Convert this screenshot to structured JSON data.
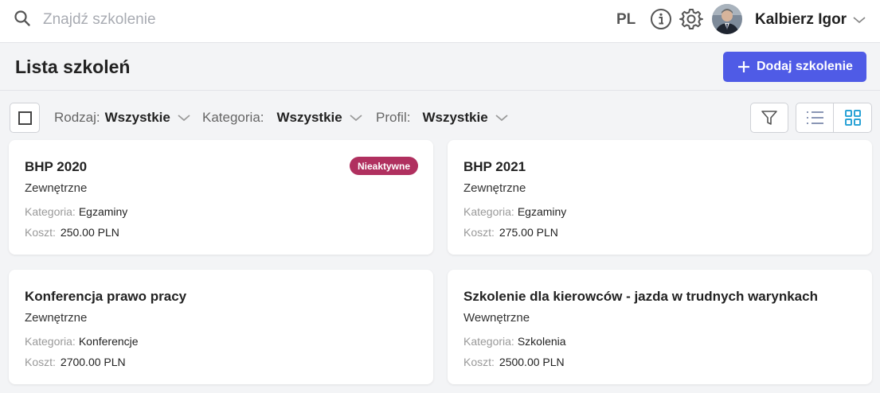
{
  "search": {
    "placeholder": "Znajdź szkolenie"
  },
  "header": {
    "language": "PL",
    "user_name": "Kalbierz Igor"
  },
  "page": {
    "title": "Lista szkoleń",
    "add_button_label": "Dodaj szkolenie"
  },
  "filters": [
    {
      "label": "Rodzaj:",
      "value": "Wszystkie"
    },
    {
      "label": "Kategoria:",
      "value": "Wszystkie"
    },
    {
      "label": "Profil:",
      "value": "Wszystkie"
    }
  ],
  "labels": {
    "category": "Kategoria:",
    "cost": "Koszt:"
  },
  "cards": [
    {
      "title": "BHP 2020",
      "type": "Zewnętrzne",
      "category": "Egzaminy",
      "cost": "250.00 PLN",
      "badge": "Nieaktywne"
    },
    {
      "title": "BHP 2021",
      "type": "Zewnętrzne",
      "category": "Egzaminy",
      "cost": "275.00 PLN"
    },
    {
      "title": "Konferencja prawo pracy",
      "type": "Zewnętrzne",
      "category": "Konferencje",
      "cost": "2700.00 PLN"
    },
    {
      "title": "Szkolenie dla kierowców - jazda w trudnych warynkach",
      "type": "Wewnętrzne",
      "category": "Szkolenia",
      "cost": "2500.00 PLN"
    }
  ],
  "colors": {
    "accent": "#4f5be6",
    "badge_inactive": "#b0305f",
    "active_view": "#2ba3d6"
  },
  "icons": [
    "search-icon",
    "info-icon",
    "gear-icon",
    "chevron-down-icon",
    "plus-icon",
    "checkbox-icon",
    "filter-funnel-icon",
    "list-view-icon",
    "grid-view-icon"
  ]
}
